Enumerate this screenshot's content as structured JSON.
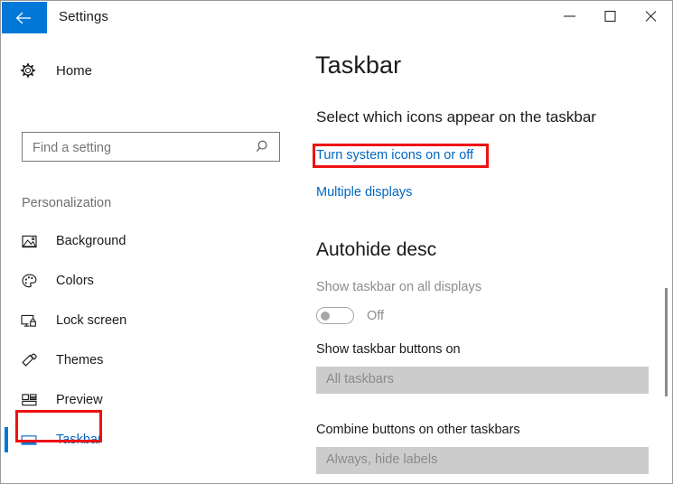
{
  "window": {
    "title": "Settings",
    "back_icon": "back-arrow-icon",
    "controls": {
      "minimize": "minimize-icon",
      "maximize": "maximize-icon",
      "close": "close-icon"
    }
  },
  "sidebar": {
    "home": {
      "label": "Home",
      "icon": "gear-icon"
    },
    "search": {
      "value": "",
      "placeholder": "Find a setting",
      "icon": "search-icon"
    },
    "group_label": "Personalization",
    "items": [
      {
        "label": "Background",
        "icon": "picture-icon",
        "selected": false
      },
      {
        "label": "Colors",
        "icon": "palette-icon",
        "selected": false
      },
      {
        "label": "Lock screen",
        "icon": "lock-screen-icon",
        "selected": false
      },
      {
        "label": "Themes",
        "icon": "paintbrush-icon",
        "selected": false
      },
      {
        "label": "Preview",
        "icon": "layout-grid-icon",
        "selected": false
      },
      {
        "label": "Taskbar",
        "icon": "taskbar-icon",
        "selected": true
      }
    ]
  },
  "content": {
    "page_title": "Taskbar",
    "subhead": "Select which icons appear on the taskbar",
    "link_system_icons": "Turn system icons on or off",
    "link_multiple_displays": "Multiple displays",
    "section_head": "Autohide desc",
    "toggle": {
      "caption": "Show taskbar on all displays",
      "state": "Off"
    },
    "fields": [
      {
        "label": "Show taskbar buttons on",
        "value": "All taskbars"
      },
      {
        "label": "Combine buttons on other taskbars",
        "value": "Always, hide labels"
      }
    ]
  },
  "annotations": {
    "color": "#ee1111",
    "targets": [
      "Turn system icons on or off",
      "Taskbar"
    ]
  },
  "colors": {
    "accent": "#0078d7",
    "link": "#0067c0",
    "disabled_text": "#8d8d8d",
    "dropdown_bg": "#cccccc"
  }
}
